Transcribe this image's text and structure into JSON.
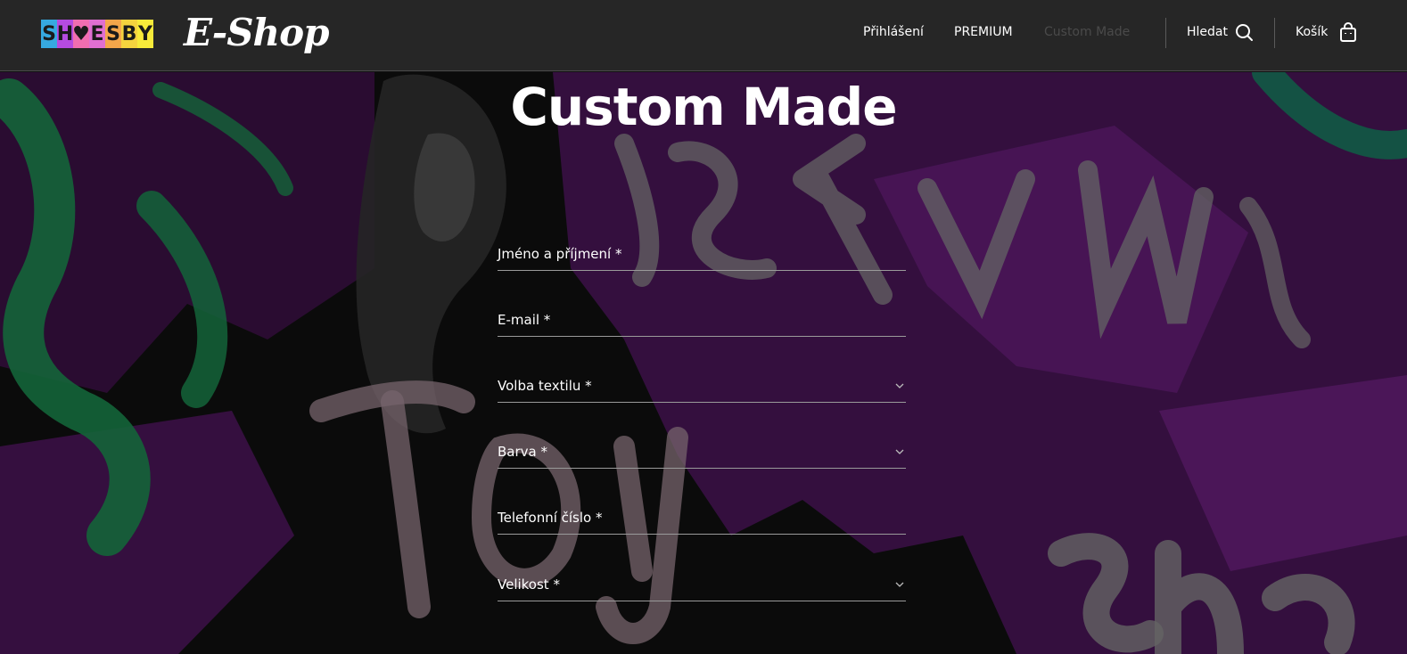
{
  "header": {
    "logo_letters": [
      "S",
      "H",
      "♥",
      "E",
      "S",
      "B",
      "Y"
    ],
    "logo_colors": [
      "#36a9e0",
      "#b54be0",
      "#f06eb0",
      "#e06fd1",
      "#f4a64a",
      "#f5d33e",
      "#f7ea3a"
    ],
    "eshop_label": "E-Shop",
    "nav": {
      "login": "Přihlášení",
      "premium": "PREMIUM",
      "custom_made": "Custom Made",
      "search": "Hledat",
      "cart": "Košík"
    }
  },
  "hero": {
    "title": "Custom Made"
  },
  "form": {
    "fields": [
      {
        "label": "Jméno a příjmení *",
        "type": "text"
      },
      {
        "label": "E-mail *",
        "type": "text"
      },
      {
        "label": "Volba textilu *",
        "type": "select"
      },
      {
        "label": "Barva *",
        "type": "select"
      },
      {
        "label": "Telefonní číslo *",
        "type": "text"
      },
      {
        "label": "Velikost *",
        "type": "select"
      }
    ]
  },
  "colors": {
    "header_bg": "#262626",
    "muted_nav": "#4a4a4a",
    "accent_purple": "#8a22a8",
    "accent_green": "#1f9a58"
  }
}
